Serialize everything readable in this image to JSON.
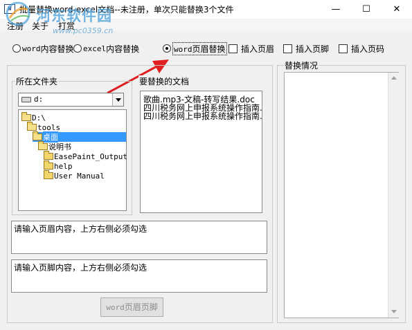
{
  "window": {
    "title": "批量替换word-excel文档--未注册，单次只能替换3个文件",
    "icon_label": "W",
    "minimize_glyph": "—",
    "maximize_glyph": "☐",
    "close_glyph": "✕"
  },
  "watermark": {
    "site_name": "河东软件园",
    "url": "www.pc0359.cn"
  },
  "menu": {
    "items": [
      "注册",
      "关于",
      "打赏"
    ]
  },
  "options": {
    "word_replace": {
      "prefix": "word",
      "label": "内容替换",
      "selected": false
    },
    "excel_replace": {
      "prefix": "excel",
      "label": "内容替换",
      "selected": false
    },
    "header_replace": {
      "prefix": "word",
      "label": "页眉替换",
      "selected": true
    },
    "insert_header": {
      "label": "插入页眉",
      "checked": false
    },
    "insert_footer": {
      "label": "插入页脚",
      "checked": false
    },
    "insert_page_no": {
      "label": "插入页码",
      "checked": false
    }
  },
  "folder_panel": {
    "title": "所在文件夹",
    "drive": "d:",
    "tree": [
      {
        "label": "D:\\",
        "level": 0,
        "open": true,
        "selected": false
      },
      {
        "label": "tools",
        "level": 1,
        "open": true,
        "selected": false
      },
      {
        "label": "桌面",
        "level": 2,
        "open": true,
        "selected": true
      },
      {
        "label": "说明书",
        "level": 3,
        "open": true,
        "selected": false
      },
      {
        "label": "EasePaint_Output",
        "level": 4,
        "open": false,
        "selected": false
      },
      {
        "label": "help",
        "level": 4,
        "open": false,
        "selected": false
      },
      {
        "label": "User Manual",
        "level": 4,
        "open": false,
        "selected": false
      }
    ]
  },
  "docs_panel": {
    "title": "要替换的文档",
    "files": [
      "歌曲.mp3-文稿-转写结果.doc",
      "四川税务网上申报系统操作指南.",
      "四川税务网上申报系统操作指南."
    ]
  },
  "header_input": {
    "value": "请输入页眉内容，上方右侧必须勾选"
  },
  "footer_input": {
    "value": "请输入页脚内容，上方右侧必须勾选"
  },
  "apply_button": {
    "prefix": "word",
    "label": "页眉页脚"
  },
  "result_panel": {
    "title": "替换情况"
  },
  "colors": {
    "accent": "#3399ff",
    "arrow": "#e02020",
    "watermark": "#4aa0d8"
  }
}
